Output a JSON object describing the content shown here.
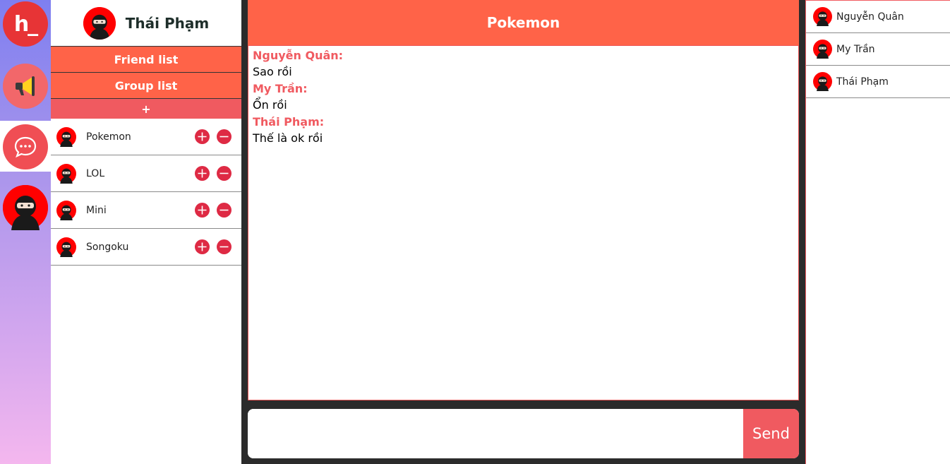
{
  "rail": {
    "logo_text": "h_",
    "icons": [
      "logo-icon",
      "megaphone-icon",
      "chat-bubble-icon",
      "ninja-avatar-icon"
    ]
  },
  "profile": {
    "name": "Thái Phạm"
  },
  "nav": {
    "friend_list": "Friend list",
    "group_list": "Group list",
    "add": "+"
  },
  "groups": [
    {
      "name": "Pokemon"
    },
    {
      "name": "LOL"
    },
    {
      "name": "Mini"
    },
    {
      "name": "Songoku"
    }
  ],
  "chat": {
    "title": "Pokemon",
    "messages": [
      {
        "author": "Nguyễn Quân:",
        "text": "Sao rồi"
      },
      {
        "author": "My Trần:",
        "text": "Ổn rồi"
      },
      {
        "author": "Thái Phạm:",
        "text": "Thế là ok rồi"
      }
    ],
    "input_value": "",
    "input_placeholder": "",
    "send_label": "Send"
  },
  "members": [
    {
      "name": "Nguyễn Quân"
    },
    {
      "name": "My Trần"
    },
    {
      "name": "Thái Phạm"
    }
  ],
  "colors": {
    "accent": "#ff6348",
    "pink": "#f05a60",
    "action": "#de2a44",
    "dark": "#2b2b2b"
  }
}
